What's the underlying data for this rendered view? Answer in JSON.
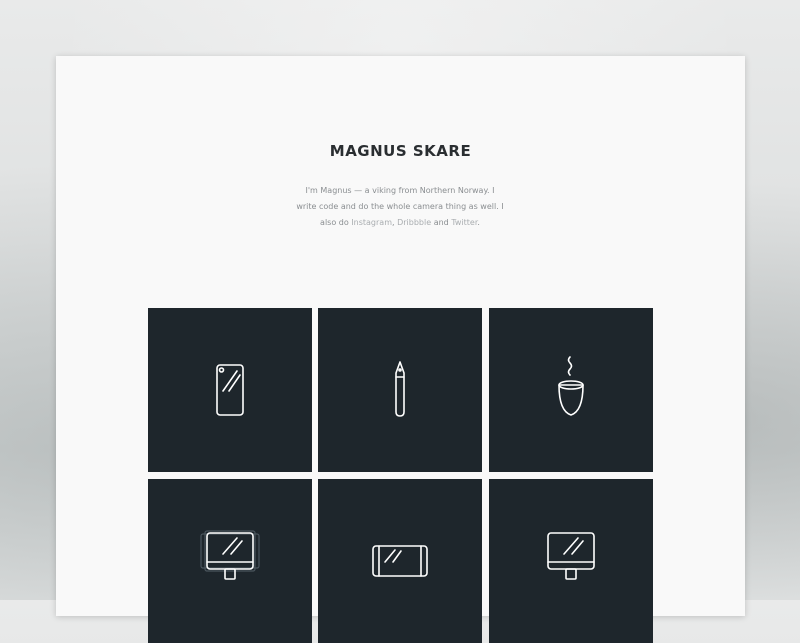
{
  "profile": {
    "name": "MAGNUS SKARE",
    "intro_text": "I'm Magnus — a viking from Northern Norway. I write code and do the whole camera thing as well. I also do",
    "and_text": "and",
    "period": ".",
    "comma": ","
  },
  "links": {
    "instagram": "Instagram",
    "dribbble": "Dribbble",
    "twitter": "Twitter"
  },
  "colors": {
    "tile_background": "#1e262c",
    "icon_stroke": "#ffffff",
    "card_background": "#f9f9f9"
  },
  "tiles": [
    {
      "icon": "phone-icon"
    },
    {
      "icon": "pen-icon"
    },
    {
      "icon": "coffee-cup-icon"
    },
    {
      "icon": "monitor-icon"
    },
    {
      "icon": "phone-landscape-icon"
    },
    {
      "icon": "monitor-icon"
    }
  ]
}
